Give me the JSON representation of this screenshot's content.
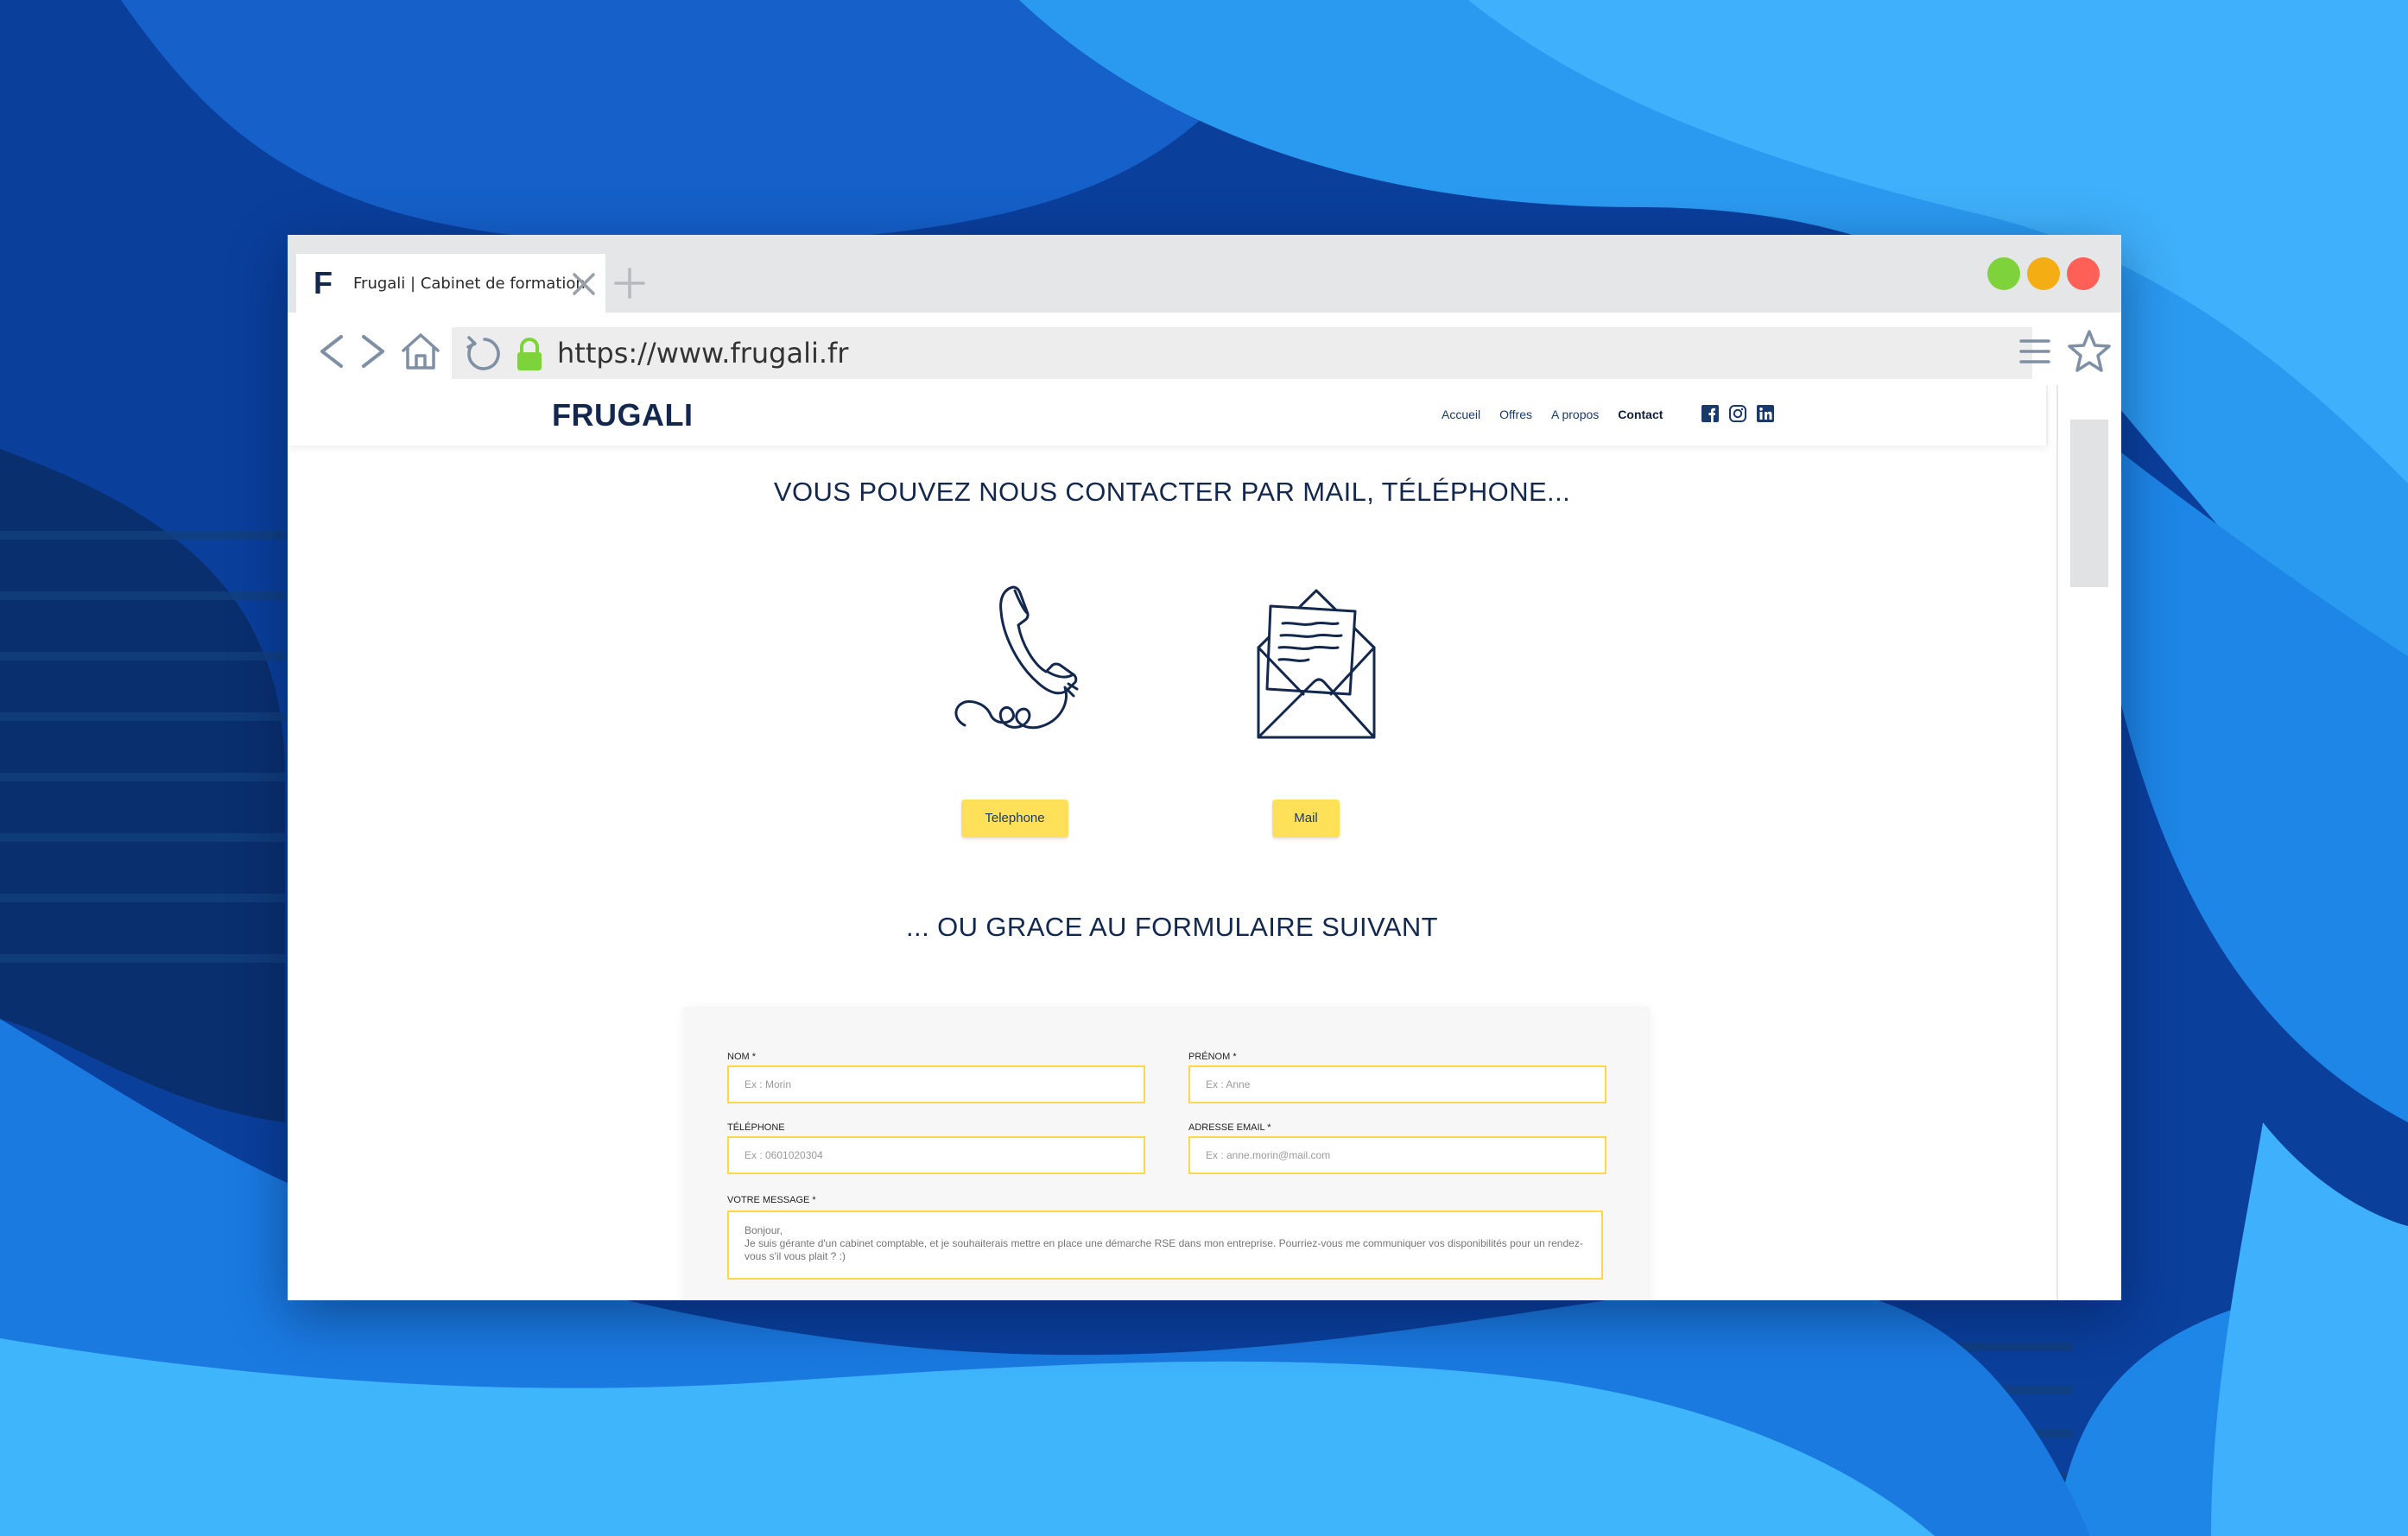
{
  "colors": {
    "accent_yellow": "#ffe058",
    "brand_navy": "#13284c",
    "bg_blue": "#0b4fb0",
    "traffic_green": "#7ed33a",
    "traffic_yellow": "#f4ad13",
    "traffic_red": "#fe5f57"
  },
  "browser": {
    "tab": {
      "favicon": "F",
      "title": "Frugali | Cabinet de formation"
    },
    "url": "https://www.frugali.fr",
    "icons": [
      "back-icon",
      "forward-icon",
      "home-icon",
      "reload-icon",
      "lock-icon",
      "menu-icon",
      "star-icon"
    ]
  },
  "site": {
    "logo": "FRUGALI",
    "nav": [
      {
        "label": "Accueil"
      },
      {
        "label": "Offres"
      },
      {
        "label": "A propos"
      },
      {
        "label": "Contact"
      }
    ],
    "social_icons": [
      "facebook-icon",
      "instagram-icon",
      "linkedin-icon"
    ],
    "contact_heading": "VOUS POUVEZ NOUS CONTACTER PAR MAIL, TÉLÉPHONE...",
    "phone_button": "Telephone",
    "mail_button": "Mail",
    "form_heading": "... OU GRACE AU FORMULAIRE SUIVANT",
    "form": {
      "nom_label": "NOM *",
      "nom_placeholder": "Ex : Morin",
      "prenom_label": "PRÉNOM *",
      "prenom_placeholder": "Ex : Anne",
      "tel_label": "TÉLÉPHONE",
      "tel_placeholder": "Ex : 0601020304",
      "email_label": "ADRESSE EMAIL *",
      "email_placeholder": "Ex : anne.morin@mail.com",
      "message_label": "VOTRE MESSAGE *",
      "message_placeholder": "Bonjour,\nJe suis gérante d'un cabinet comptable, et je souhaiterais mettre en place une démarche RSE dans mon entreprise. Pourriez-vous me communiquer vos disponibilités pour un rendez-vous s'il vous plait ? :)"
    }
  }
}
